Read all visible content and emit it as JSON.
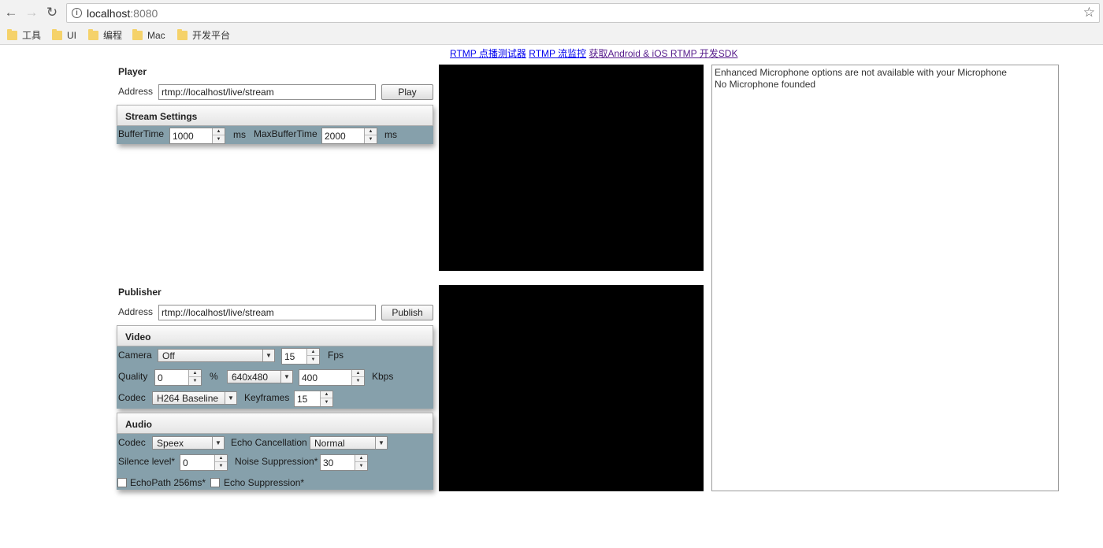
{
  "browser": {
    "url_host": "localhost",
    "url_port": ":8080",
    "bookmarks": [
      "工具",
      "UI",
      "编程",
      "Mac",
      "开发平台"
    ]
  },
  "links": {
    "player_test": "RTMP 点播测试器",
    "monitor": "RTMP 流监控",
    "sdk": "获取Android & iOS RTMP 开发SDK"
  },
  "player": {
    "title": "Player",
    "address_label": "Address",
    "address_value": "rtmp://localhost/live/stream",
    "play_label": "Play",
    "stream_settings": {
      "title": "Stream Settings",
      "buffer_time_label": "BufferTime",
      "buffer_time": "1000",
      "buffer_unit": "ms",
      "max_buffer_label": "MaxBufferTime",
      "max_buffer": "2000",
      "max_buffer_unit": "ms"
    }
  },
  "publisher": {
    "title": "Publisher",
    "address_label": "Address",
    "address_value": "rtmp://localhost/live/stream",
    "publish_label": "Publish",
    "video": {
      "title": "Video",
      "camera_label": "Camera",
      "camera_value": "Off",
      "fps": "15",
      "fps_label": "Fps",
      "quality_label": "Quality",
      "quality": "0",
      "quality_unit": "%",
      "resolution": "640x480",
      "bitrate": "400",
      "bitrate_unit": "Kbps",
      "codec_label": "Codec",
      "codec_value": "H264 Baseline",
      "keyframes_label": "Keyframes",
      "keyframes": "15"
    },
    "audio": {
      "title": "Audio",
      "codec_label": "Codec",
      "codec_value": "Speex",
      "echo_cancel_label": "Echo Cancellation",
      "echo_cancel_value": "Normal",
      "silence_label": "Silence level*",
      "silence": "0",
      "noise_label": "Noise Suppression*",
      "noise": "30",
      "echopath_label": "EchoPath 256ms*",
      "echo_suppression_label": "Echo Suppression*"
    }
  },
  "log": {
    "lines": [
      "Enhanced Microphone options are not available with your Microphone",
      "No Microphone founded"
    ]
  },
  "colors": {
    "panel_bg": "#86a0ab",
    "video_bg": "#000000",
    "link": "#0000ee",
    "visited_link": "#551a8b"
  }
}
